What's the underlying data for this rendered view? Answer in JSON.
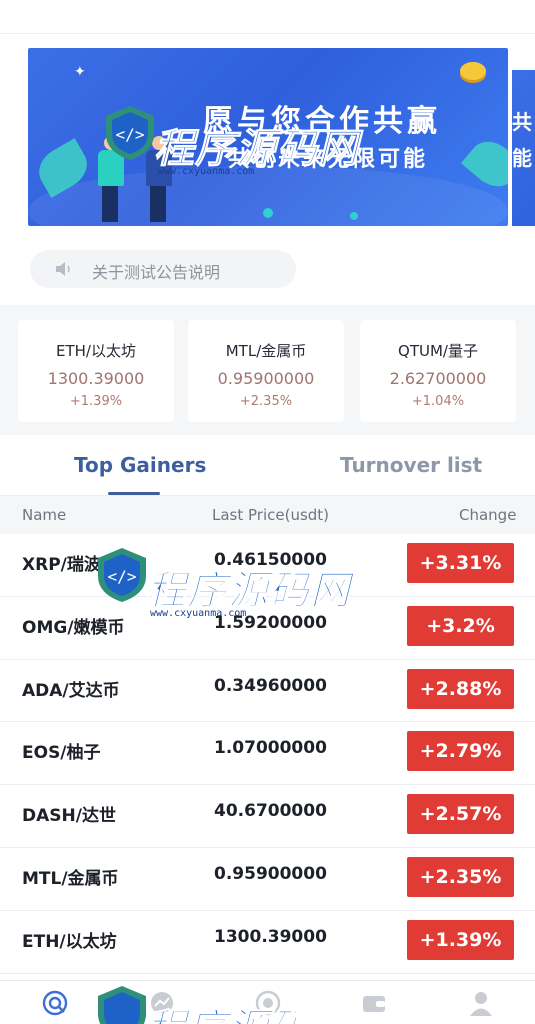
{
  "banner": {
    "title_line1": "愿与您合作共赢",
    "title_line2": "共创未来无限可能",
    "peek_line1": "共",
    "peek_line2": "能"
  },
  "notice": {
    "icon": "speaker-icon",
    "text": "关于测试公告说明"
  },
  "tickers": [
    {
      "pair": "ETH/以太坊",
      "price": "1300.39000",
      "change": "+1.39%"
    },
    {
      "pair": "MTL/金属币",
      "price": "0.95900000",
      "change": "+2.35%"
    },
    {
      "pair": "QTUM/量子",
      "price": "2.62700000",
      "change": "+1.04%"
    }
  ],
  "tabs": {
    "active": "Top Gainers",
    "inactive": "Turnover list"
  },
  "table": {
    "headers": {
      "name": "Name",
      "price": "Last Price(usdt)",
      "change": "Change"
    },
    "rows": [
      {
        "name": "XRP/瑞波币",
        "price": "0.46150000",
        "change": "+3.31%"
      },
      {
        "name": "OMG/嫩模币",
        "price": "1.59200000",
        "change": "+3.2%"
      },
      {
        "name": "ADA/艾达币",
        "price": "0.34960000",
        "change": "+2.88%"
      },
      {
        "name": "EOS/柚子",
        "price": "1.07000000",
        "change": "+2.79%"
      },
      {
        "name": "DASH/达世",
        "price": "40.6700000",
        "change": "+2.57%"
      },
      {
        "name": "MTL/金属币",
        "price": "0.95900000",
        "change": "+2.35%"
      },
      {
        "name": "ETH/以太坊",
        "price": "1300.39000",
        "change": "+1.39%"
      }
    ]
  },
  "bottom_nav": [
    {
      "icon": "home-icon",
      "active": true
    },
    {
      "icon": "market-chart-icon",
      "active": false
    },
    {
      "icon": "trade-exchange-icon",
      "active": false
    },
    {
      "icon": "wallet-icon",
      "active": false
    },
    {
      "icon": "user-profile-icon",
      "active": false
    }
  ],
  "watermark": {
    "text": "程序源码网",
    "url": "www.cxyuanma.com"
  },
  "colors": {
    "accent": "#3e5f9e",
    "up": "#e03c35",
    "banner": "#3c6fe6"
  }
}
